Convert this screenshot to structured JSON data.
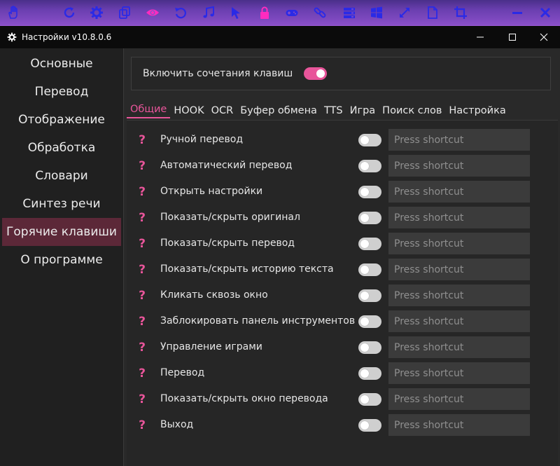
{
  "colors": {
    "accent": "#e8559a",
    "toolbar_icon": "#2a2ae6",
    "active_nav_bg": "#5c2838"
  },
  "toolbar": {
    "icons": [
      "hand-icon",
      "refresh-icon",
      "settings-gear-icon",
      "copy-icon",
      "eye-icon",
      "undo-icon",
      "music-icon",
      "cursor-icon",
      "lock-icon",
      "gamepad-icon",
      "link-icon",
      "layers-icon",
      "windows-icon",
      "resize-icon",
      "file-icon",
      "crop-icon",
      "minimize-icon",
      "close-icon"
    ]
  },
  "window": {
    "title": "Настройки v10.8.0.6"
  },
  "sidebar": {
    "items": [
      {
        "label": "Основные"
      },
      {
        "label": "Перевод"
      },
      {
        "label": "Отображение"
      },
      {
        "label": "Обработка"
      },
      {
        "label": "Словари"
      },
      {
        "label": "Синтез речи"
      },
      {
        "label": "Горячие клавиши",
        "active": true
      },
      {
        "label": "О программе"
      }
    ]
  },
  "hotkeys": {
    "enable_label": "Включить сочетания клавиш",
    "enabled": true
  },
  "tabs": [
    {
      "label": "Общие",
      "active": true
    },
    {
      "label": "HOOK"
    },
    {
      "label": "OCR"
    },
    {
      "label": "Буфер обмена"
    },
    {
      "label": "TTS"
    },
    {
      "label": "Игра"
    },
    {
      "label": "Поиск слов"
    },
    {
      "label": "Настройка"
    }
  ],
  "shortcut_placeholder": "Press shortcut",
  "shortcuts": [
    {
      "label": "Ручной перевод",
      "enabled": false
    },
    {
      "label": "Автоматический перевод",
      "enabled": false
    },
    {
      "label": "Открыть настройки",
      "enabled": false
    },
    {
      "label": "Показать/скрыть оригинал",
      "enabled": false
    },
    {
      "label": "Показать/скрыть перевод",
      "enabled": false
    },
    {
      "label": "Показать/скрыть историю текста",
      "enabled": false
    },
    {
      "label": "Кликать сквозь окно",
      "enabled": false
    },
    {
      "label": "Заблокировать панель инструментов",
      "enabled": false
    },
    {
      "label": "Управление играми",
      "enabled": false
    },
    {
      "label": "Перевод",
      "enabled": false
    },
    {
      "label": "Показать/скрыть окно перевода",
      "enabled": false
    },
    {
      "label": "Выход",
      "enabled": false
    }
  ]
}
